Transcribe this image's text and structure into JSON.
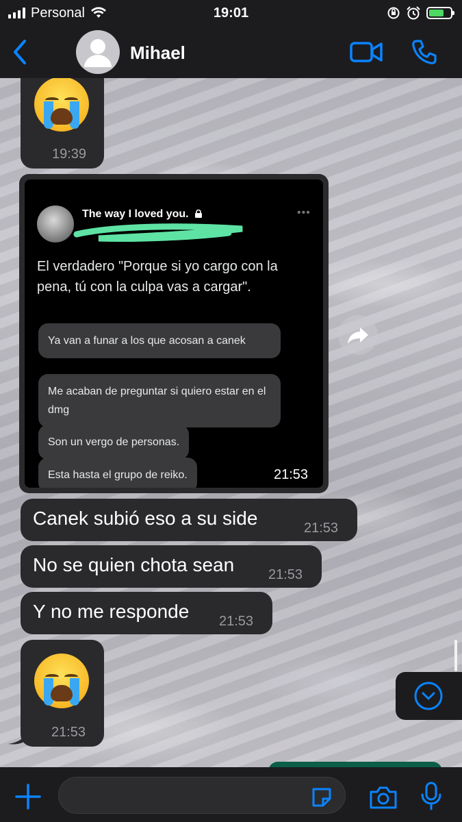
{
  "status_bar": {
    "carrier": "Personal",
    "time": "19:01",
    "battery_color": "#4cd964"
  },
  "header": {
    "contact_name": "Mihael"
  },
  "messages": [
    {
      "kind": "emoji",
      "emoji": "loudly-crying-face",
      "time": "19:39"
    },
    {
      "kind": "image",
      "time": "21:53",
      "screenshot": {
        "account_name": "The way I loved you.",
        "tweet_text": "El verdadero \"Porque si yo cargo con la pena, tú con la culpa vas a cargar\".",
        "chat_lines": [
          "Ya van a funar a los que acosan a canek",
          "Me acaban de preguntar si quiero estar en el dmg",
          "Son un vergo de personas.",
          "Esta hasta el grupo de reiko."
        ]
      }
    },
    {
      "kind": "text",
      "text": "Canek subió eso a su side",
      "time": "21:53"
    },
    {
      "kind": "text",
      "text": "No se quien chota sean",
      "time": "21:53"
    },
    {
      "kind": "text",
      "text": "Y no me responde",
      "time": "21:53"
    },
    {
      "kind": "emoji",
      "emoji": "loudly-crying-face",
      "time": "21:53"
    }
  ],
  "input": {
    "placeholder": "",
    "value": ""
  },
  "colors": {
    "accent": "#0a84ff",
    "bubble": "#2a2a2c",
    "bar": "#1c1c1e"
  }
}
